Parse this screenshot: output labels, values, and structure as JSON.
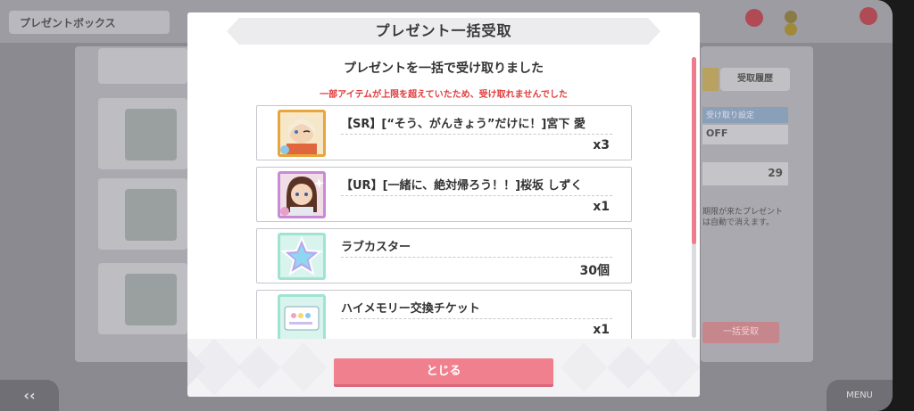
{
  "background": {
    "title": "プレゼントボックス",
    "right_button": "受取履歴",
    "toggle_label": "受け取り設定",
    "toggle_value": "OFF",
    "count": "29",
    "note": "期限が来たプレゼントは自動で消えます。",
    "pink_button": "一括受取",
    "back_label": "‹‹",
    "menu_label": "MENU"
  },
  "modal": {
    "title": "プレゼント一括受取",
    "message": "プレゼントを一括で受け取りました",
    "warning": "一部アイテムが上限を超えていたため、受け取れませんでした",
    "close_label": "とじる"
  },
  "items": [
    {
      "name": "【SR】[“そう、がんきょう”だけに！]宮下 愛",
      "qty": "x3",
      "icon": "sr-card-icon"
    },
    {
      "name": "【UR】[一緒に、絶対帰ろう！！]桜坂 しずく",
      "qty": "x1",
      "icon": "ur-card-icon"
    },
    {
      "name": "ラブカスター",
      "qty": "30個",
      "icon": "star-icon"
    },
    {
      "name": "ハイメモリー交換チケット",
      "qty": "x1",
      "icon": "ticket-icon"
    }
  ],
  "colors": {
    "accent_pink": "#f1808e",
    "warning_red": "#e23a3a",
    "scroll_pink": "#ef7c8c"
  }
}
